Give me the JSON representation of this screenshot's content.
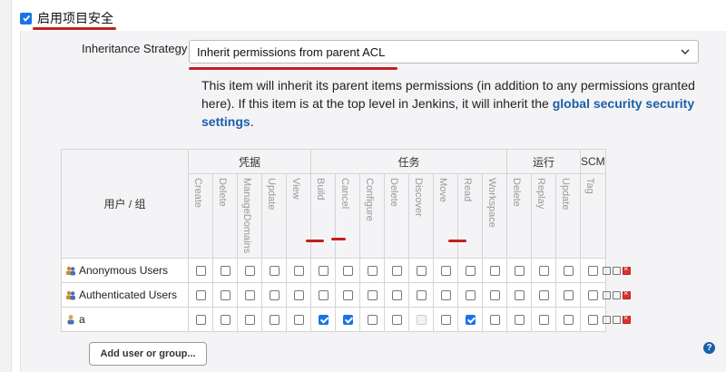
{
  "enable": {
    "label": "启用项目安全",
    "checked": true
  },
  "strategy": {
    "label": "Inheritance Strategy",
    "selected": "Inherit permissions from parent ACL"
  },
  "description": {
    "text": "This item will inherit its parent items permissions (in addition to any permissions granted here). If this item is at the top level in Jenkins, it will inherit the ",
    "link": "global security security settings",
    "end": "."
  },
  "matrix": {
    "user_header": "用户 / 组",
    "groups": [
      {
        "label": "凭据"
      },
      {
        "label": "任务"
      },
      {
        "label": "运行"
      },
      {
        "label": "SCM"
      }
    ],
    "permissions": [
      "Create",
      "Delete",
      "ManageDomains",
      "Update",
      "View",
      "Build",
      "Cancel",
      "Configure",
      "Delete",
      "Discover",
      "Move",
      "Read",
      "Workspace",
      "Delete",
      "Replay",
      "Update",
      "Tag"
    ],
    "rows": [
      {
        "name": "Anonymous Users",
        "icon": "group-icon",
        "checks": [
          0,
          0,
          0,
          0,
          0,
          0,
          0,
          0,
          0,
          0,
          0,
          0,
          0,
          0,
          0,
          0,
          0
        ]
      },
      {
        "name": "Authenticated Users",
        "icon": "group-icon",
        "checks": [
          0,
          0,
          0,
          0,
          0,
          0,
          0,
          0,
          0,
          0,
          0,
          0,
          0,
          0,
          0,
          0,
          0
        ]
      },
      {
        "name": "a",
        "icon": "user-icon",
        "checks": [
          0,
          0,
          0,
          0,
          0,
          1,
          1,
          0,
          0,
          2,
          0,
          1,
          0,
          0,
          0,
          0,
          0
        ]
      }
    ]
  },
  "add_button": "Add user or group...",
  "help_icon": "?"
}
